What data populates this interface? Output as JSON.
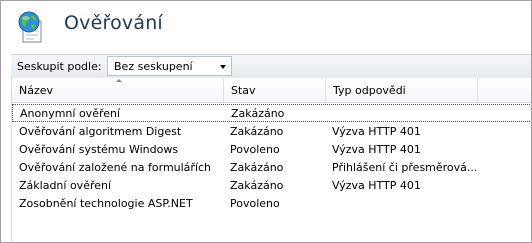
{
  "page": {
    "title": "Ověřování"
  },
  "grouping": {
    "label": "Seskupit podle:",
    "selected": "Bez seskupení"
  },
  "columns": [
    "Název",
    "Stav",
    "Typ odpovědi"
  ],
  "rows": [
    {
      "name": "Anonymní ověření",
      "status": "Zakázáno",
      "response": ""
    },
    {
      "name": "Ověřování algoritmem Digest",
      "status": "Zakázáno",
      "response": "Výzva HTTP 401"
    },
    {
      "name": "Ověřování systému Windows",
      "status": "Povoleno",
      "response": "Výzva HTTP 401"
    },
    {
      "name": "Ověřování založené na formulářích",
      "status": "Zakázáno",
      "response": "Přihlášení či přesměrová..."
    },
    {
      "name": "Základní ověření",
      "status": "Zakázáno",
      "response": "Výzva HTTP 401"
    },
    {
      "name": "Zosobnění technologie ASP.NET",
      "status": "Povoleno",
      "response": ""
    }
  ],
  "colors": {
    "title": "#1e395b",
    "grid_border": "#d5dbe3"
  },
  "icons": {
    "header": "globe-document-icon"
  }
}
